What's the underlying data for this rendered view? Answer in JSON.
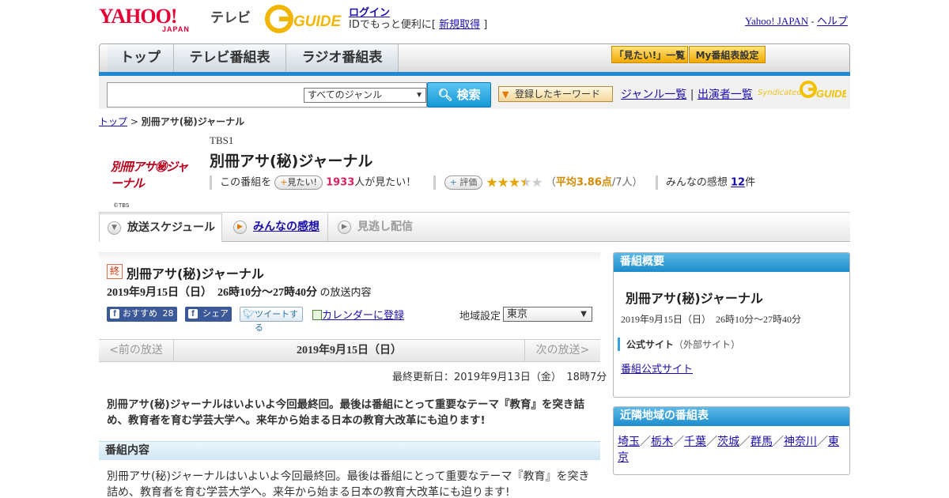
{
  "header": {
    "yahoo_logo": "YAHOO!",
    "yahoo_sub": "JAPAN",
    "tv_label": "テレビ",
    "gguide_logo": "G GUIDE",
    "login": "ログイン",
    "signup_prefix": "IDでもっと便利に[",
    "signup_link": "新規取得",
    "signup_suffix": "]",
    "yahoo_japan_link": "Yahoo! JAPAN",
    "help_link": "ヘルプ",
    "sep": " - "
  },
  "nav": {
    "tabs": [
      "トップ",
      "テレビ番組表",
      "ラジオ番組表"
    ],
    "mitai_list": "「見たい!」一覧",
    "my_schedule": "My番組表設定"
  },
  "search": {
    "placeholder": "",
    "genre": "すべてのジャンル",
    "button": "検索",
    "keyword_button": "登録したキーワード",
    "genre_list": "ジャンル一覧",
    "performer_list": "出演者一覧",
    "divider": "|",
    "syndicated": "Syndicated"
  },
  "breadcrumb": {
    "top": "トップ",
    "sep": ">",
    "current": "別冊アサ(秘)ジャーナル"
  },
  "program": {
    "logo_text": "別冊アサ㊙ジャーナル",
    "logo_copy": "©TBS",
    "channel": "TBS1",
    "title": "別冊アサ(秘)ジャーナル",
    "want_prefix": "この番組を",
    "want_button": "見たい!",
    "want_count": "1933",
    "want_suffix": "人が見たい！",
    "rate_button": "評価",
    "rating_open": "（",
    "rating_avg": "平均3.86点",
    "rating_people": "/7人）",
    "impressions_label": "みんなの感想",
    "impressions_count": "12",
    "impressions_unit": "件"
  },
  "tabs": [
    "放送スケジュール",
    "みんなの感想",
    "見逃し配信"
  ],
  "episode": {
    "badge": "終",
    "title": "別冊アサ(秘)ジャーナル",
    "time": "2019年9月15日（日）　26時10分～27時40分",
    "time_suffix": "の放送内容",
    "fb_recommend": "おすすめ",
    "fb_count": "28",
    "fb_share": "シェア",
    "tweet": "ツイートする",
    "calendar": "カレンダーに登録",
    "region_label": "地域設定",
    "region_value": "東京",
    "prev": "<前の放送",
    "date": "2019年9月15日（日）",
    "next": "次の放送>",
    "updated": "最終更新日：2019年9月13日（金）　18時7分",
    "summary": "別冊アサ(秘)ジャーナルはいよいよ今回最終回。最後は番組にとって重要なテーマ『教育』を突き詰め、教育者を育む学芸大学へ。来年から始まる日本の教育大改革にも迫ります!",
    "section_title": "番組内容",
    "section_body": "別冊アサ(秘)ジャーナルはいよいよ今回最終回。最後は番組にとって重要なテーマ『教育』を突き詰め、教育者を育む学芸大学へ。来年から始まる日本の教育大改革にも迫ります!"
  },
  "sidebar": {
    "overview_title": "番組概要",
    "overview_program": "別冊アサ(秘)ジャーナル",
    "overview_time": "2019年9月15日（日）　26時10分～27時40分",
    "official_label": "公式サイト",
    "official_note": "（外部サイト）",
    "official_link": "番組公式サイト",
    "nearby_title": "近隣地域の番組表",
    "nearby": [
      "埼玉",
      "栃木",
      "千葉",
      "茨城",
      "群馬",
      "神奈川",
      "東京"
    ],
    "nearby_sep": "／"
  },
  "rating_value": 3.86,
  "rating_max": 5,
  "colors": {
    "accent_blue": "#1e88d0",
    "pink": "#d6245e",
    "star": "#e4a500"
  }
}
